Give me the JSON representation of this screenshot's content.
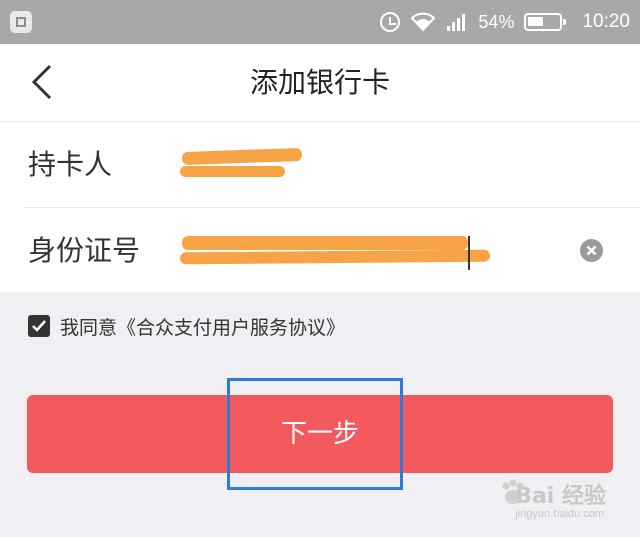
{
  "status_bar": {
    "battery_percent": "54%",
    "battery_level": 0.54,
    "time": "10:20",
    "icons": [
      "app-notification-icon",
      "alarm-icon",
      "wifi-icon",
      "signal-icon",
      "battery-icon"
    ]
  },
  "nav": {
    "back_icon": "chevron-left-icon",
    "title": "添加银行卡"
  },
  "form": {
    "cardholder_label": "持卡人",
    "cardholder_value": "",
    "id_label": "身份证号",
    "id_value": "",
    "clear_icon": "clear-icon"
  },
  "agreement": {
    "checked": true,
    "text": "我同意《合众支付用户服务协议》"
  },
  "next_button": {
    "label": "下一步"
  },
  "colors": {
    "accent": "#f35a5d",
    "highlight": "#2e7bd6",
    "redaction": "#f7a446"
  },
  "watermark": {
    "brand": "Bai 经验",
    "url": "jingyan.baidu.com"
  }
}
